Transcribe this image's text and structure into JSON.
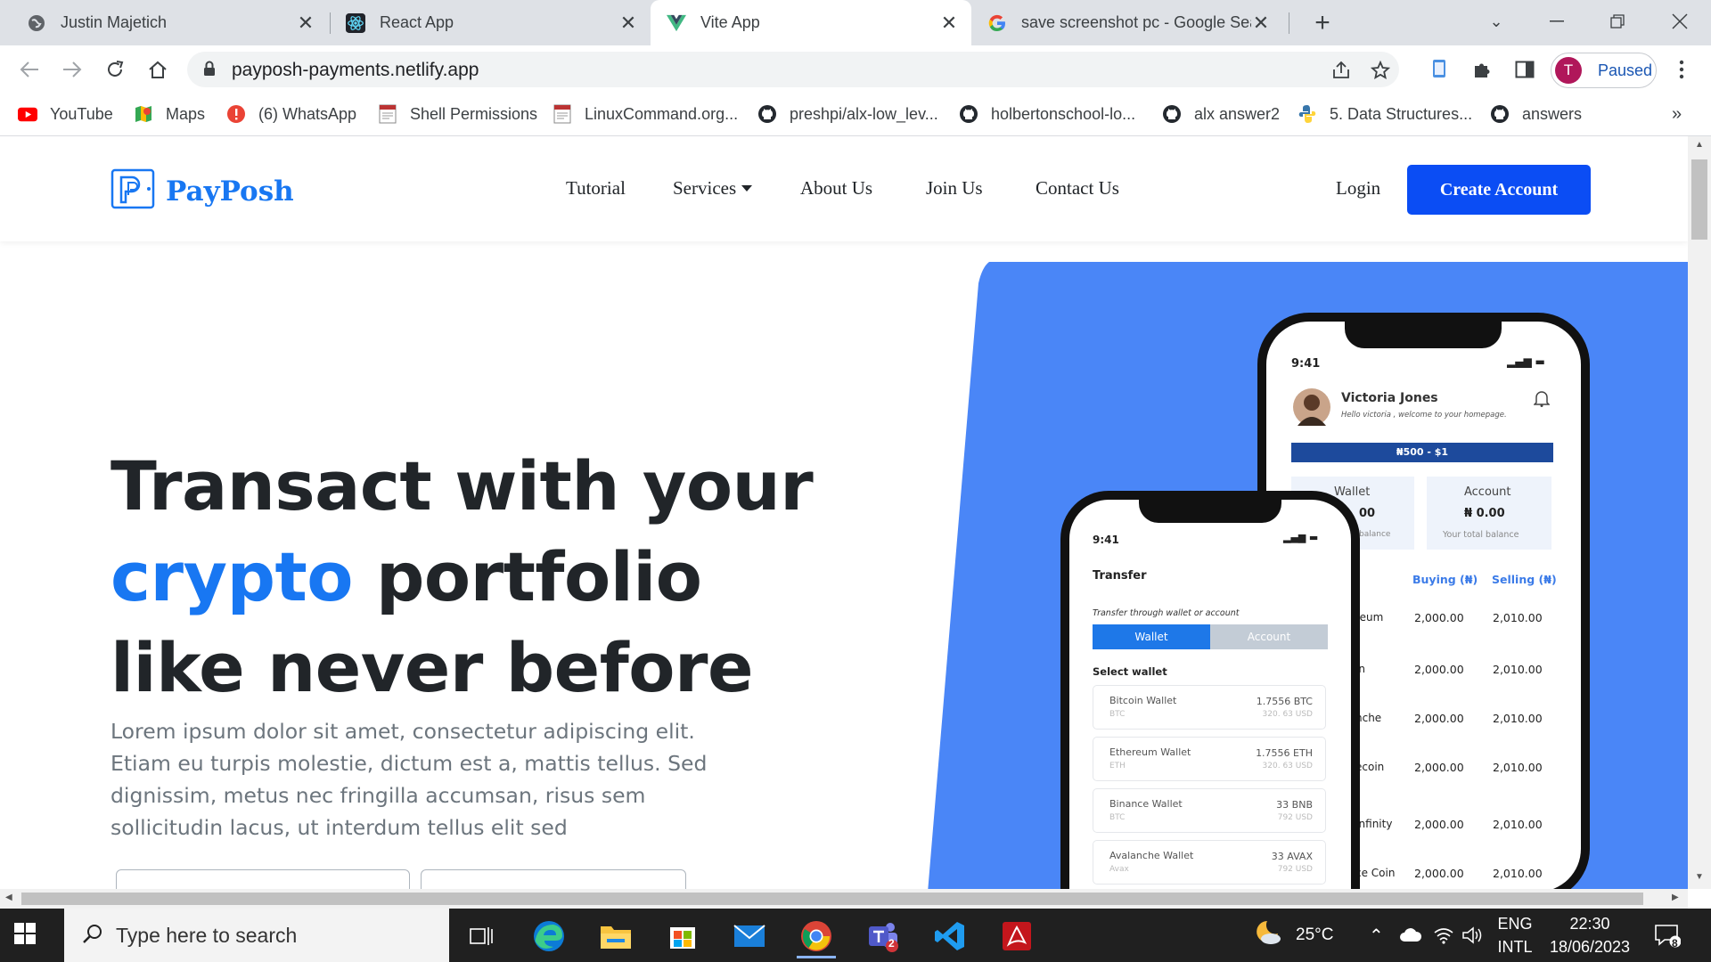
{
  "browser": {
    "tabs": [
      {
        "title": "Justin Majetich",
        "icon": "globe-icon",
        "active": false
      },
      {
        "title": "React App",
        "icon": "react-icon",
        "active": false
      },
      {
        "title": "Vite App",
        "icon": "vue-icon",
        "active": true
      },
      {
        "title": "save screenshot pc - Google Sear",
        "icon": "google-icon",
        "active": false
      }
    ],
    "url": "payposh-payments.netlify.app",
    "profile_initial": "T",
    "profile_status": "Paused",
    "bookmarks": [
      {
        "label": "YouTube",
        "icon": "youtube-icon"
      },
      {
        "label": "Maps",
        "icon": "maps-icon"
      },
      {
        "label": "(6) WhatsApp",
        "icon": "alert-icon"
      },
      {
        "label": "Shell Permissions",
        "icon": "page-icon"
      },
      {
        "label": "LinuxCommand.org...",
        "icon": "page-icon"
      },
      {
        "label": "preshpi/alx-low_lev...",
        "icon": "github-icon"
      },
      {
        "label": "holbertonschool-lo...",
        "icon": "github-icon"
      },
      {
        "label": "alx answer2",
        "icon": "github-icon"
      },
      {
        "label": "5. Data Structures...",
        "icon": "python-icon"
      },
      {
        "label": "answers",
        "icon": "github-icon"
      }
    ],
    "bookmarks_more": "»"
  },
  "site": {
    "brand": "PayPosh",
    "brand_color": "#1877f2",
    "nav": [
      {
        "label": "Tutorial"
      },
      {
        "label": "Services",
        "dropdown": true
      },
      {
        "label": "About Us"
      },
      {
        "label": "Join Us"
      },
      {
        "label": "Contact Us"
      }
    ],
    "login": "Login",
    "create_account": "Create Account",
    "hero": {
      "line1": "Transact with your",
      "accent": "crypto",
      "line2_rest": " portfolio",
      "line3": "like never before",
      "body": "Lorem ipsum dolor sit amet, consectetur adipiscing elit. Etiam eu turpis molestie, dictum est a, mattis tellus. Sed dignissim, metus nec fringilla accumsan, risus sem sollicitudin lacus, ut interdum tellus elit sed"
    },
    "back_phone": {
      "time": "9:41",
      "user": "Victoria Jones",
      "greeting": "Hello victoria , welcome to your homepage.",
      "rate": "₦500 - $1",
      "wallet_label": "Wallet",
      "wallet_value": "00",
      "wallet_sub": "balance",
      "account_label": "Account",
      "account_value": "₦ 0.00",
      "account_sub": "Your total balance",
      "col_buy": "Buying (₦)",
      "col_sell": "Selling (₦)",
      "rows": [
        {
          "coin": "reum",
          "buy": "2,000.00",
          "sell": "2,010.00"
        },
        {
          "coin": "in",
          "buy": "2,000.00",
          "sell": "2,010.00"
        },
        {
          "coin": "nche",
          "buy": "2,000.00",
          "sell": "2,010.00"
        },
        {
          "coin": "ecoin",
          "buy": "2,000.00",
          "sell": "2,010.00"
        },
        {
          "coin": "Infinity",
          "buy": "2,000.00",
          "sell": "2,010.00"
        },
        {
          "coin": "ce Coin",
          "buy": "2,000.00",
          "sell": "2,010.00"
        }
      ]
    },
    "front_phone": {
      "time": "9:41",
      "title": "Transfer",
      "subtitle": "Transfer through wallet or account",
      "tab_wallet": "Wallet",
      "tab_account": "Account",
      "select_label": "Select wallet",
      "wallets": [
        {
          "name": "Bitcoin Wallet",
          "ticker": "BTC",
          "amount": "1.7556 BTC",
          "usd": "320. 63 USD"
        },
        {
          "name": "Ethereum Wallet",
          "ticker": "ETH",
          "amount": "1.7556 ETH",
          "usd": "320. 63 USD"
        },
        {
          "name": "Binance Wallet",
          "ticker": "BTC",
          "amount": "33 BNB",
          "usd": "792 USD"
        },
        {
          "name": "Avalanche Wallet",
          "ticker": "Avax",
          "amount": "33 AVAX",
          "usd": "792 USD"
        }
      ]
    }
  },
  "taskbar": {
    "search_placeholder": "Type here to search",
    "weather": "25°C",
    "lang1": "ENG",
    "lang2": "INTL",
    "time": "22:30",
    "date": "18/06/2023",
    "notif_count": "8",
    "teams_badge": "2"
  }
}
